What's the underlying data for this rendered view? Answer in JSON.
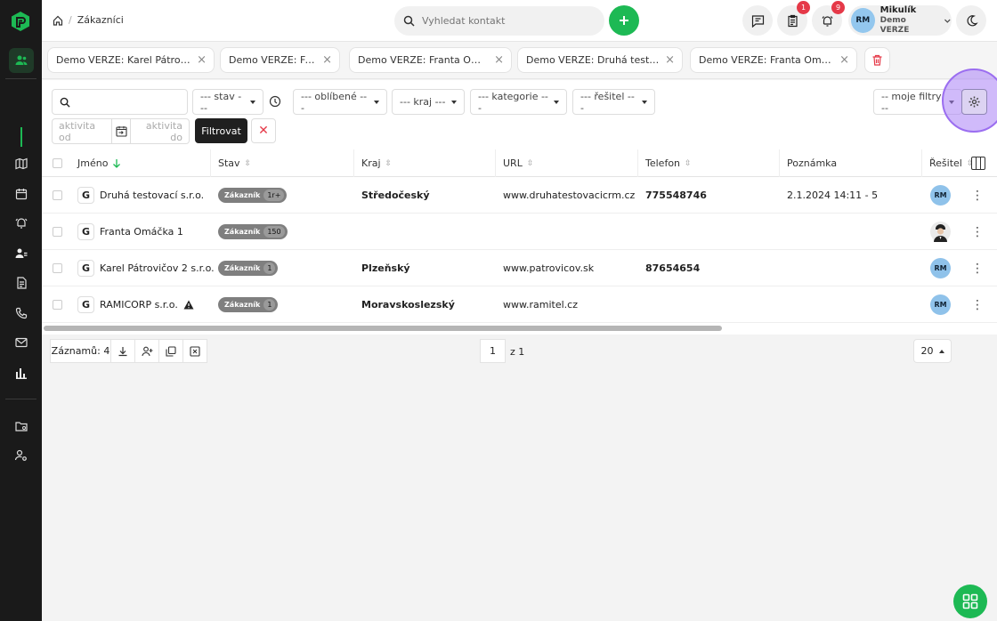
{
  "breadcrumb": {
    "current": "Zákazníci"
  },
  "search": {
    "placeholder": "Vyhledat kontakt"
  },
  "badges": {
    "tasks": "1",
    "notifications": "9"
  },
  "user": {
    "initials": "RM",
    "name": "Mikulík",
    "company": "Demo VERZE"
  },
  "tabs": [
    {
      "label": "Demo VERZE: Karel Pátrovič..."
    },
    {
      "label": "Demo VERZE: Franta"
    },
    {
      "label": "Demo VERZE: Franta Omáčka"
    },
    {
      "label": "Demo VERZE: Druhá testova..."
    },
    {
      "label": "Demo VERZE: Franta Omáčk..."
    }
  ],
  "filters": {
    "stav": "--- stav ---",
    "oblibene": "--- oblíbené ---",
    "kraj": "--- kraj ---",
    "kategorie": "--- kategorie ---",
    "resitel": "--- řešitel ---",
    "moje_filtry": "-- moje filtry --",
    "aktivita_od": "aktivita od",
    "aktivita_do": "aktivita do",
    "filter_button": "Filtrovat"
  },
  "columns": {
    "jmeno": "Jméno",
    "stav": "Stav",
    "kraj": "Kraj",
    "url": "URL",
    "telefon": "Telefon",
    "poznamka": "Poznámka",
    "resitel": "Řešitel"
  },
  "rows": [
    {
      "name": "Druhá testovací s.r.o.",
      "status": "Zákazník",
      "count": "1r+",
      "region": "Středočeský",
      "url": "www.druhatestovacicrm.cz",
      "phone": "775548746",
      "note": "2.1.2024 14:11 - 5",
      "assignee": "RM"
    },
    {
      "name": "Franta Omáčka 1",
      "status": "Zákazník",
      "count": "150",
      "region": "",
      "url": "",
      "phone": "",
      "note": "",
      "assignee": ""
    },
    {
      "name": "Karel Pátrovičov 2 s.r.o.",
      "status": "Zákazník",
      "count": "1",
      "region": "Plzeňský",
      "url": "www.patrovicov.sk",
      "phone": "87654654",
      "note": "",
      "assignee": "RM"
    },
    {
      "name": "RAMICORP s.r.o.",
      "status": "Zákazník",
      "count": "1",
      "region": "Moravskoslezský",
      "url": "www.ramitel.cz",
      "phone": "",
      "note": "",
      "assignee": "RM"
    }
  ],
  "footer": {
    "records": "Záznamů: 4",
    "page": "1",
    "of_pages": "z 1",
    "per_page": "20"
  }
}
